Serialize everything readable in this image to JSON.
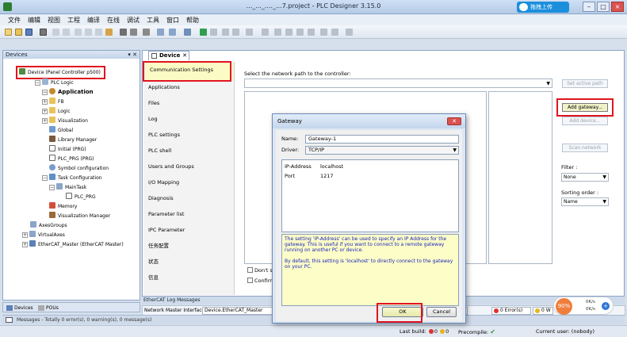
{
  "window": {
    "title": "..._..._...._...7.project - PLC Designer 3.15.0",
    "upload_label": "拖拽上传",
    "minimize": "–",
    "maximize": "□",
    "close": "×"
  },
  "menu": [
    "文件",
    "编辑",
    "视图",
    "工程",
    "编译",
    "在线",
    "调试",
    "工具",
    "窗口",
    "帮助"
  ],
  "devices_panel": {
    "header": "Devices",
    "pin": "▾ ✕",
    "tree": [
      {
        "label": "Device (Panel Controller p500)",
        "bold": false
      },
      {
        "label": "PLC Logic",
        "bold": false
      },
      {
        "label": "Application",
        "bold": true
      },
      {
        "label": "FB",
        "bold": false
      },
      {
        "label": "Logic",
        "bold": false
      },
      {
        "label": "Visualization",
        "bold": false
      },
      {
        "label": "Global",
        "bold": false
      },
      {
        "label": "Library Manager",
        "bold": false
      },
      {
        "label": "Initial (PRG)",
        "bold": false
      },
      {
        "label": "PLC_PRG (PRG)",
        "bold": false
      },
      {
        "label": "Symbol configuration",
        "bold": false
      },
      {
        "label": "Task Configuration",
        "bold": false
      },
      {
        "label": "MainTask",
        "bold": false
      },
      {
        "label": "PLC_PRG",
        "bold": false
      },
      {
        "label": "Memory",
        "bold": false
      },
      {
        "label": "Visualization Manager",
        "bold": false
      },
      {
        "label": "AxesGroups",
        "bold": false
      },
      {
        "label": "VirtualAxes",
        "bold": false
      },
      {
        "label": "EtherCAT_Master (EtherCAT Master)",
        "bold": false
      }
    ],
    "bottom_tabs": [
      "Devices",
      "POUs"
    ]
  },
  "editor": {
    "tab_label": "Device",
    "tab_close": "✕",
    "categories": [
      "Communication Settings",
      "Applications",
      "Files",
      "Log",
      "PLC settings",
      "PLC shell",
      "Users and Groups",
      "I/O Mapping",
      "Diagnosis",
      "Parameter list",
      "IPC Parameter",
      "任务配置",
      "状态",
      "信息"
    ],
    "select_label": "Select the network path to the controller:",
    "side_buttons": {
      "set_active_path": "Set active path",
      "add_gateway": "Add gateway...",
      "add_device": "Add device...",
      "scan_network": "Scan network"
    },
    "filter_label": "Filter :",
    "filter_value": "None",
    "sorting_label": "Sorting order :",
    "sorting_value": "Name",
    "check_dont": "Don't s",
    "check_confirm": "Confirm"
  },
  "log": {
    "strip_title": "EtherCAT Log Messages",
    "network_label": "Network Master Interface",
    "network_value": "Device.EtherCAT_Master",
    "errors": "0 Error(s)",
    "warnings": "0 W"
  },
  "messages_strip": "Messages - Totally 0 error(s), 0 warning(s), 0 message(s)",
  "statusbar": {
    "last_build_label": "Last build:",
    "build_errors": "0",
    "build_warnings": "0",
    "precompile_label": "Precompile:",
    "current_user": "Current user: (nobody)"
  },
  "net_widget": {
    "percent": "90%",
    "up": "0K/s",
    "down": "0K/s",
    "plus": "+"
  },
  "dialog": {
    "title": "Gateway",
    "close": "✕",
    "name_label": "Name:",
    "name_value": "Gateway-1",
    "driver_label": "Driver:",
    "driver_value": "TCP/IP",
    "properties": [
      {
        "key": "IP-Address",
        "value": "localhost"
      },
      {
        "key": "Port",
        "value": "1217"
      }
    ],
    "info_p1": "The setting 'IP-Address' can be used to specify an IP Address for the gateway. This is useful if you want to connect to a remote gateway running on another PC or device.",
    "info_p2": "By default, this setting is 'localhost' to directly connect to the gateway on your PC.",
    "ok": "OK",
    "cancel": "Cancel"
  },
  "colors": {
    "highlight_box": "#e0141e",
    "info_text": "#1a26b8",
    "info_bg": "#fdfdc8",
    "chrome_bg": "#d6e0ec"
  }
}
